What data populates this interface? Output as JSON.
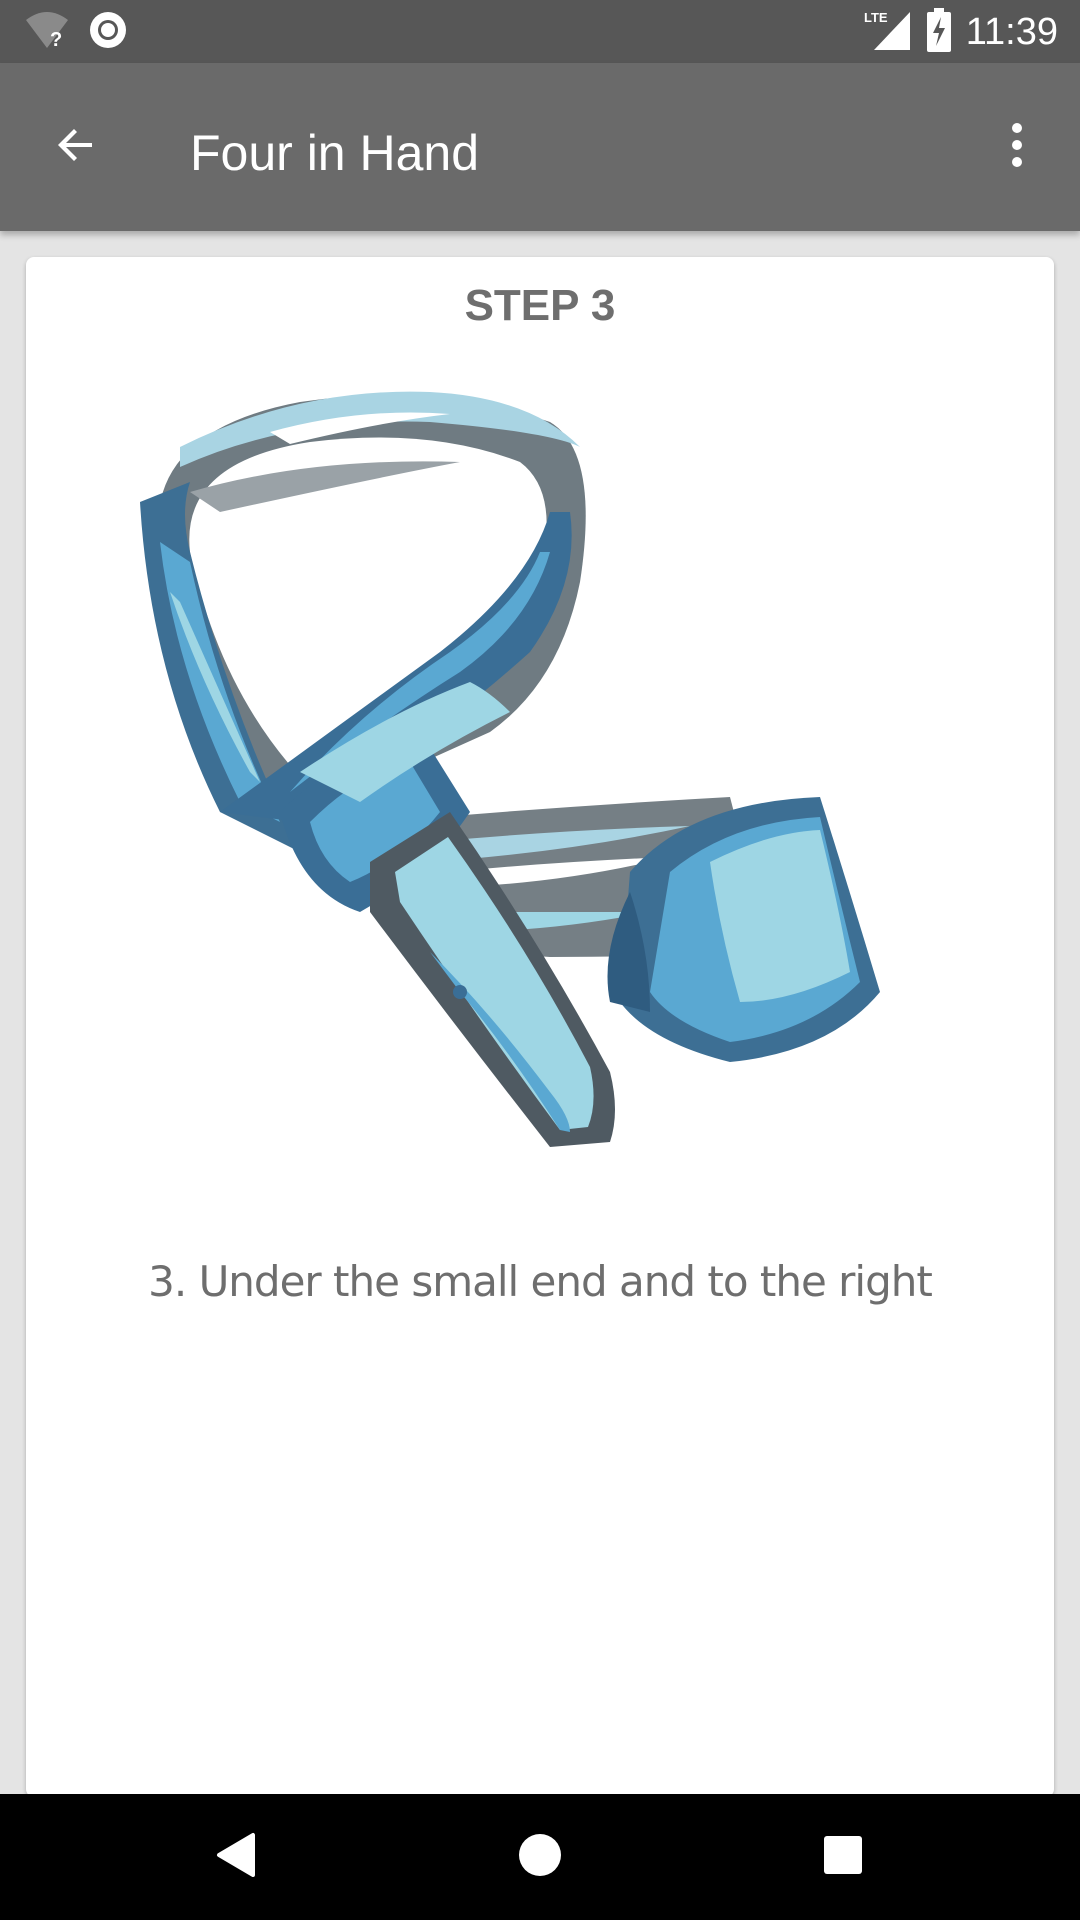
{
  "status_bar": {
    "time": "11:39",
    "network_label": "LTE",
    "icons": [
      "wifi-unknown-icon",
      "record-icon",
      "cell-signal-icon",
      "battery-charging-icon"
    ]
  },
  "app_bar": {
    "title": "Four in Hand",
    "back_icon": "arrow-back-icon",
    "menu_icon": "more-vert-icon"
  },
  "step": {
    "heading": "STEP 3",
    "description": "3. Under the small end and to the right",
    "image": "tie-knot-step-illustration"
  },
  "nav_bar": {
    "icons": [
      "back-triangle-icon",
      "home-circle-icon",
      "recents-square-icon"
    ]
  },
  "colors": {
    "status_bar": "#575757",
    "app_bar": "#6a6a6a",
    "background": "#e4e4e4",
    "card": "#ffffff",
    "text_gray": "#6e6e6e",
    "tie_light": "#9ed6e4",
    "tie_mid": "#5aa8d2",
    "tie_dark": "#3a6e96",
    "tie_outline": "#4f5a62"
  }
}
